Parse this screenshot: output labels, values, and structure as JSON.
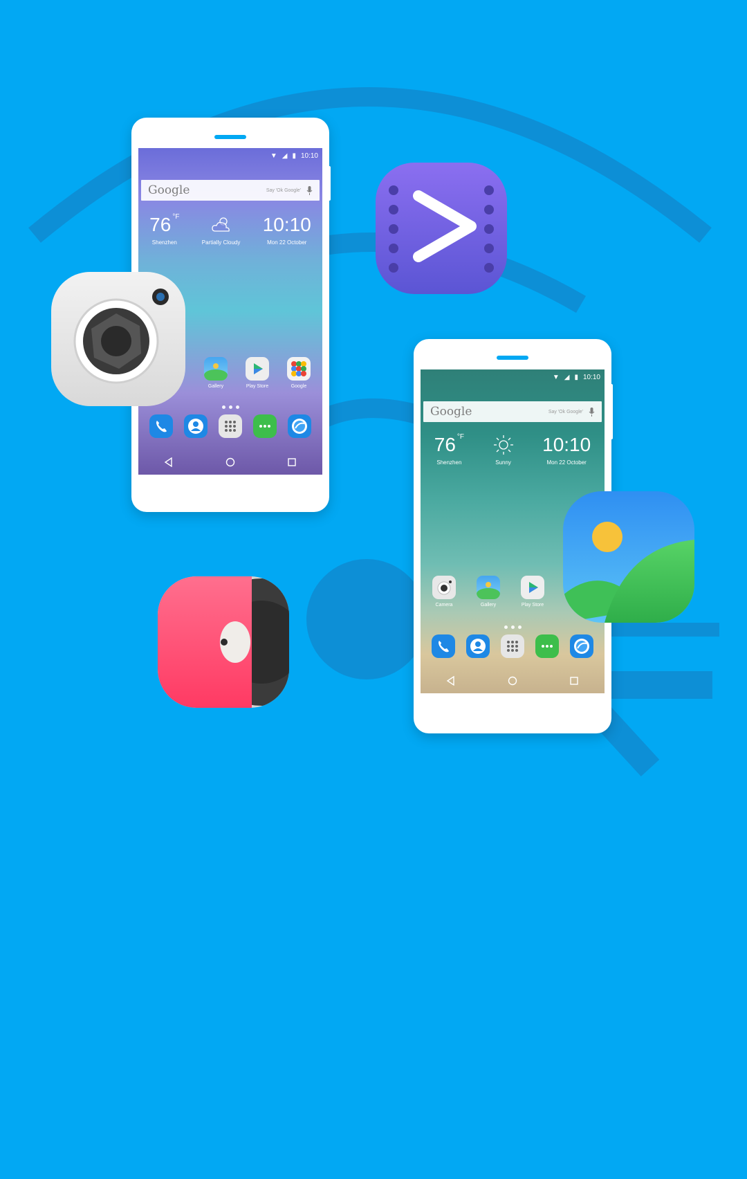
{
  "colors": {
    "background": "#02a8f3",
    "watermark": "#0d8fd6",
    "accent": "#02a8f3"
  },
  "phone_left": {
    "status_time": "10:10",
    "search": {
      "logo": "Google",
      "hint": "Say 'Ok Google'",
      "mic_icon": "mic-icon"
    },
    "weather": {
      "temp": "76",
      "temp_unit": "°F",
      "city": "Shenzhen",
      "condition_icon": "partly-cloudy-icon",
      "condition": "Partially  Cloudy",
      "time": "10:10",
      "date": "Mon 22 October"
    },
    "apps": [
      {
        "label": "Gallery",
        "icon": "gallery-icon"
      },
      {
        "label": "Play Store",
        "icon": "play-store-icon"
      },
      {
        "label": "Google",
        "icon": "google-folder-icon"
      }
    ],
    "dock": [
      "phone-icon",
      "contacts-icon",
      "app-drawer-icon",
      "messaging-icon",
      "browser-icon"
    ],
    "nav": [
      "back-icon",
      "home-icon",
      "recents-icon"
    ]
  },
  "phone_right": {
    "status_time": "10:10",
    "search": {
      "logo": "Google",
      "hint": "Say 'Ok Google'",
      "mic_icon": "mic-icon"
    },
    "weather": {
      "temp": "76",
      "temp_unit": "°F",
      "city": "Shenzhen",
      "condition_icon": "sunny-icon",
      "condition": "Sunny",
      "time": "10:10",
      "date": "Mon 22 October"
    },
    "apps": [
      {
        "label": "Camera",
        "icon": "camera-icon"
      },
      {
        "label": "Gallery",
        "icon": "gallery-icon"
      },
      {
        "label": "Play Store",
        "icon": "play-store-icon"
      }
    ],
    "dock": [
      "phone-icon",
      "contacts-icon",
      "app-drawer-icon",
      "messaging-icon",
      "browser-icon"
    ],
    "nav": [
      "back-icon",
      "home-icon",
      "recents-icon"
    ]
  },
  "floating_icons": [
    "camera-app-icon",
    "video-player-icon",
    "music-player-icon",
    "gallery-app-icon"
  ]
}
